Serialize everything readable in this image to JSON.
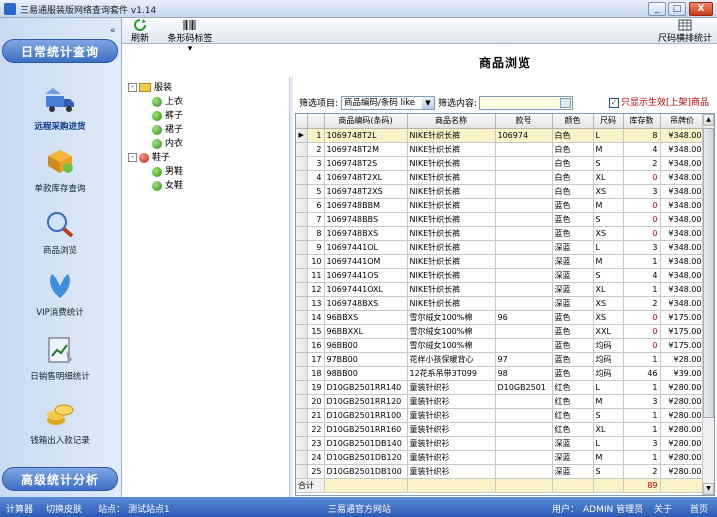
{
  "window": {
    "title": "三易通服装版网络查询套件 v1.14",
    "min_label": "_",
    "max_label": "□",
    "close_label": "X"
  },
  "toolbar": {
    "refresh_label": "刷新",
    "barcode_label": "条形码标签",
    "size_label": "尺码横排统计"
  },
  "sidebar": {
    "collapse_label": "«",
    "header_top": "日常统计查询",
    "items": [
      {
        "label": "远程采购进货",
        "icon": "truck-icon"
      },
      {
        "label": "单款库存查询",
        "icon": "boxes-icon"
      },
      {
        "label": "商品浏览",
        "icon": "magnifier-icon"
      },
      {
        "label": "VIP消费统计",
        "icon": "vip-icon"
      },
      {
        "label": "日销售明细统计",
        "icon": "chart-icon"
      },
      {
        "label": "钱箱出入款记录",
        "icon": "coins-icon"
      }
    ],
    "header_bottom": "高级统计分析"
  },
  "tree": {
    "root1": "服装",
    "root1_children": [
      "上衣",
      "裤子",
      "裙子",
      "内衣"
    ],
    "root2": "鞋子",
    "root2_children": [
      "男鞋",
      "女鞋"
    ]
  },
  "main": {
    "title": "商品浏览",
    "filter_label": "筛选项目:",
    "filter_value": "商品编码/条码 like",
    "content_label": "筛选内容:",
    "only_active_label": "只显示生效[上架]商品",
    "columns": [
      "",
      "",
      "商品编码(条码)",
      "商品名称",
      "款号",
      "颜色",
      "尺码",
      "库存数",
      "吊牌价"
    ],
    "rows": [
      [
        "1",
        "1069748T2L",
        "NIKE针织长裤",
        "106974",
        "白色",
        "L",
        "8",
        "¥348.00"
      ],
      [
        "2",
        "1069748T2M",
        "NIKE针织长裤",
        "",
        "白色",
        "M",
        "4",
        "¥348.00"
      ],
      [
        "3",
        "1069748T2S",
        "NIKE针织长裤",
        "",
        "白色",
        "S",
        "2",
        "¥348.00"
      ],
      [
        "4",
        "1069748T2XL",
        "NIKE针织长裤",
        "",
        "白色",
        "XL",
        "0",
        "¥348.00"
      ],
      [
        "5",
        "1069748T2XS",
        "NIKE针织长裤",
        "",
        "白色",
        "XS",
        "3",
        "¥348.00"
      ],
      [
        "6",
        "1069748BBM",
        "NIKE针织长裤",
        "",
        "蓝色",
        "M",
        "0",
        "¥348.00"
      ],
      [
        "7",
        "1069748BBS",
        "NIKE针织长裤",
        "",
        "蓝色",
        "S",
        "0",
        "¥348.00"
      ],
      [
        "8",
        "1069748BXS",
        "NIKE针织长裤",
        "",
        "蓝色",
        "XS",
        "0",
        "¥348.00"
      ],
      [
        "9",
        "10697441OL",
        "NIKE针织长裤",
        "",
        "深蓝",
        "L",
        "3",
        "¥348.00"
      ],
      [
        "10",
        "10697441OM",
        "NIKE针织长裤",
        "",
        "深蓝",
        "M",
        "1",
        "¥348.00"
      ],
      [
        "11",
        "10697441OS",
        "NIKE针织长裤",
        "",
        "深蓝",
        "S",
        "4",
        "¥348.00"
      ],
      [
        "12",
        "10697441OXL",
        "NIKE针织长裤",
        "",
        "深蓝",
        "XL",
        "1",
        "¥348.00"
      ],
      [
        "13",
        "1069748BXS",
        "NIKE针织长裤",
        "",
        "深蓝",
        "XS",
        "2",
        "¥348.00"
      ],
      [
        "14",
        "96BBXS",
        "雪尔绒女100%棉",
        "96",
        "蓝色",
        "XS",
        "0",
        "¥175.00"
      ],
      [
        "15",
        "96BBXXL",
        "雪尔绒女100%棉",
        "",
        "蓝色",
        "XXL",
        "0",
        "¥175.00"
      ],
      [
        "16",
        "96BB00",
        "雪尔绒女100%棉",
        "",
        "蓝色",
        "均码",
        "0",
        "¥175.00"
      ],
      [
        "17",
        "97BB00",
        "花样小孩保暖背心",
        "97",
        "蓝色",
        "均码",
        "1",
        "¥28.00"
      ],
      [
        "18",
        "98BB00",
        "12花系吊带3T099",
        "98",
        "蓝色",
        "均码",
        "46",
        "¥39.00"
      ],
      [
        "19",
        "D10GB2501RR140",
        "童装针织衫",
        "D10GB2501",
        "红色",
        "L",
        "1",
        "¥280.00"
      ],
      [
        "20",
        "D10GB2501RR120",
        "童装针织衫",
        "",
        "红色",
        "M",
        "3",
        "¥280.00"
      ],
      [
        "21",
        "D10GB2501RR100",
        "童装针织衫",
        "",
        "红色",
        "S",
        "1",
        "¥280.00"
      ],
      [
        "22",
        "D10GB2501RR160",
        "童装针织衫",
        "",
        "红色",
        "XL",
        "1",
        "¥280.00"
      ],
      [
        "23",
        "D10GB2501DB140",
        "童装针织衫",
        "",
        "深蓝",
        "L",
        "3",
        "¥280.00"
      ],
      [
        "24",
        "D10GB2501DB120",
        "童装针织衫",
        "",
        "深蓝",
        "M",
        "1",
        "¥280.00"
      ],
      [
        "25",
        "D10GB2501DB100",
        "童装针织衫",
        "",
        "深蓝",
        "S",
        "2",
        "¥280.00"
      ]
    ],
    "total_label": "合计",
    "total_stock": "89"
  },
  "status": {
    "calculator": "计算器",
    "skin": "切换皮肤",
    "station_label": "站点：",
    "station": "测试站点1",
    "website": "三易通官方网站",
    "user_label": "用户：",
    "user": "ADMIN 管理员",
    "about": "关于",
    "home": "首页"
  },
  "colors": {
    "accent": "#3e6fc4",
    "zero_stock": "#d00000",
    "selected_row": "#fbf3c8"
  }
}
